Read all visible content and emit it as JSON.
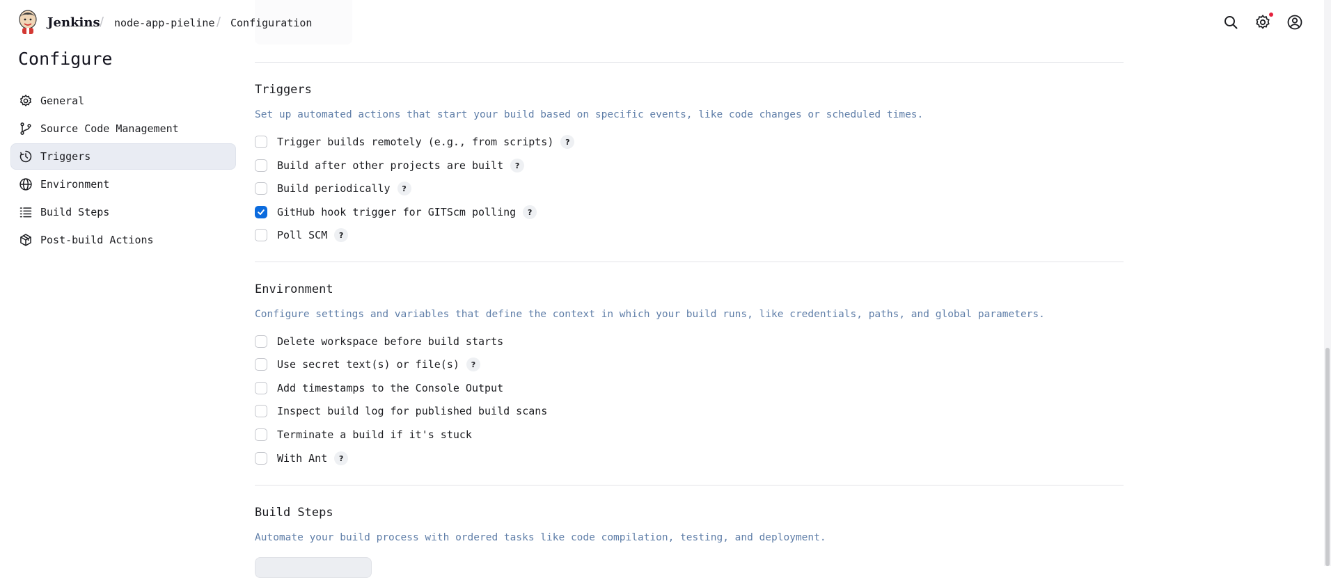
{
  "header": {
    "brand": "Jenkins",
    "breadcrumbs": [
      "node-app-pieline",
      "Configuration"
    ],
    "icons": [
      "search-icon",
      "settings-icon",
      "user-icon"
    ]
  },
  "sidebar": {
    "title": "Configure",
    "items": [
      {
        "label": "General",
        "icon": "gear-icon"
      },
      {
        "label": "Source Code Management",
        "icon": "source-control-icon"
      },
      {
        "label": "Triggers",
        "icon": "clock-icon",
        "active": true
      },
      {
        "label": "Environment",
        "icon": "globe-icon"
      },
      {
        "label": "Build Steps",
        "icon": "list-icon"
      },
      {
        "label": "Post-build Actions",
        "icon": "package-icon"
      }
    ]
  },
  "triggers": {
    "title": "Triggers",
    "description": "Set up automated actions that start your build based on specific events, like code changes or scheduled times.",
    "options": [
      {
        "label": "Trigger builds remotely (e.g., from scripts)",
        "checked": false,
        "help": "?"
      },
      {
        "label": "Build after other projects are built",
        "checked": false,
        "help": "?"
      },
      {
        "label": "Build periodically",
        "checked": false,
        "help": "?"
      },
      {
        "label": "GitHub hook trigger for GITScm polling",
        "checked": true,
        "help": "?"
      },
      {
        "label": "Poll SCM",
        "checked": false,
        "help": "?"
      }
    ]
  },
  "environment": {
    "title": "Environment",
    "description": "Configure settings and variables that define the context in which your build runs, like credentials, paths, and global parameters.",
    "options": [
      {
        "label": "Delete workspace before build starts",
        "checked": false
      },
      {
        "label": "Use secret text(s) or file(s)",
        "checked": false,
        "help": "?"
      },
      {
        "label": "Add timestamps to the Console Output",
        "checked": false
      },
      {
        "label": "Inspect build log for published build scans",
        "checked": false
      },
      {
        "label": "Terminate a build if it's stuck",
        "checked": false
      },
      {
        "label": "With Ant",
        "checked": false,
        "help": "?"
      }
    ]
  },
  "build_steps": {
    "title": "Build Steps",
    "description": "Automate your build process with ordered tasks like code compilation, testing, and deployment."
  },
  "colors": {
    "accent": "#0b6bde",
    "description_text": "#5f7ea8",
    "active_nav_bg": "#e9ecf3",
    "notification_dot": "#e5213c"
  }
}
